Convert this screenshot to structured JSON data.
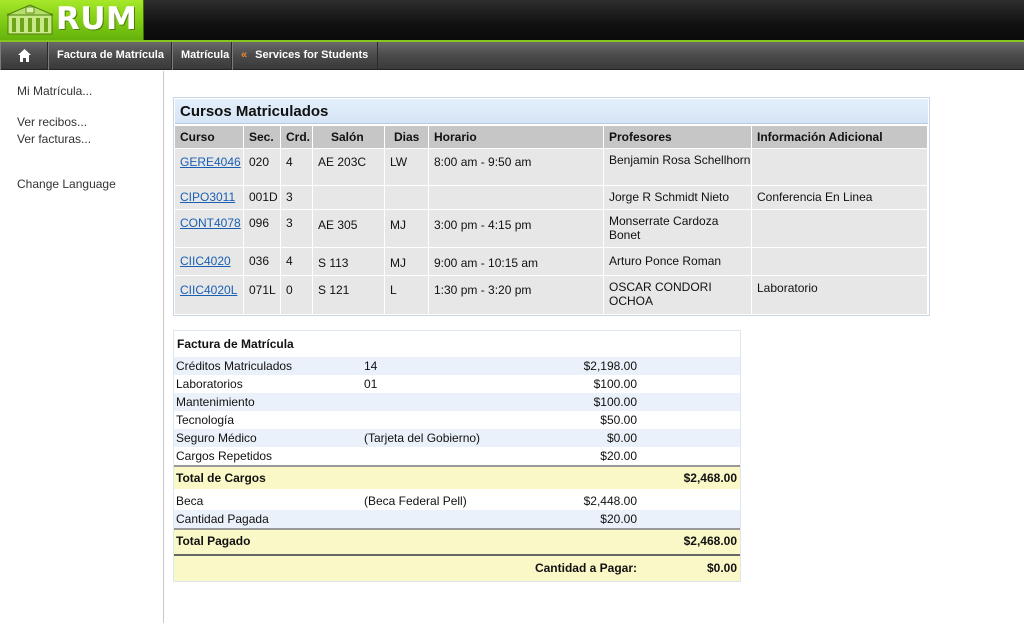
{
  "header": {
    "logo_text": "RUM"
  },
  "nav": {
    "items": [
      {
        "label": "Factura de Matrícula"
      },
      {
        "label": "Matrícula"
      },
      {
        "label": "Services for Students"
      }
    ]
  },
  "sidebar": {
    "items": [
      {
        "label": "Mi Matrícula..."
      },
      {
        "label": "Ver recibos..."
      },
      {
        "label": "Ver facturas..."
      },
      {
        "label": "Change Language"
      }
    ]
  },
  "courses": {
    "title": "Cursos Matriculados",
    "headers": [
      "Curso",
      "Sec.",
      "Crd.",
      "Salón",
      "Dias",
      "Horario",
      "Profesores",
      "Información Adicional"
    ],
    "rows": [
      {
        "curso": "GERE4046",
        "sec": "020",
        "crd": "4",
        "salon": "AE 203C",
        "dias": "LW",
        "horario": "8:00 am - 9:50 am",
        "profesores": "Benjamin Rosa Schellhorn",
        "info": ""
      },
      {
        "curso": "CIPO3011",
        "sec": "001D",
        "crd": "3",
        "salon": "",
        "dias": "",
        "horario": "",
        "profesores": "Jorge R Schmidt Nieto",
        "info": "Conferencia En Linea"
      },
      {
        "curso": "CONT4078",
        "sec": "096",
        "crd": "3",
        "salon": "AE 305",
        "dias": "MJ",
        "horario": "3:00 pm - 4:15 pm",
        "profesores": "Monserrate Cardoza Bonet",
        "info": ""
      },
      {
        "curso": "CIIC4020",
        "sec": "036",
        "crd": "4",
        "salon": "S 113",
        "dias": "MJ",
        "horario": "9:00 am - 10:15 am",
        "profesores": "Arturo Ponce Roman",
        "info": ""
      },
      {
        "curso": "CIIC4020L",
        "sec": "071L",
        "crd": "0",
        "salon": "S 121",
        "dias": "L",
        "horario": "1:30 pm - 3:20 pm",
        "profesores": "OSCAR CONDORI OCHOA",
        "info": "Laboratorio"
      }
    ]
  },
  "invoice": {
    "title": "Factura de Matrícula",
    "charges": [
      {
        "label": "Créditos Matriculados",
        "desc": "14",
        "amount": "$2,198.00"
      },
      {
        "label": "Laboratorios",
        "desc": "01",
        "amount": "$100.00"
      },
      {
        "label": "Mantenimiento",
        "desc": "",
        "amount": "$100.00"
      },
      {
        "label": "Tecnología",
        "desc": "",
        "amount": "$50.00"
      },
      {
        "label": "Seguro Médico",
        "desc": "(Tarjeta del Gobierno)",
        "amount": "$0.00"
      },
      {
        "label": "Cargos Repetidos",
        "desc": "",
        "amount": "$20.00"
      }
    ],
    "total_cargos_label": "Total de Cargos",
    "total_cargos": "$2,468.00",
    "payments": [
      {
        "label": "Beca",
        "desc": "(Beca Federal Pell)",
        "amount": "$2,448.00"
      },
      {
        "label": "Cantidad Pagada",
        "desc": "",
        "amount": "$20.00"
      }
    ],
    "total_pagado_label": "Total Pagado",
    "total_pagado": "$2,468.00",
    "a_pagar_label": "Cantidad a Pagar:",
    "a_pagar": "$0.00"
  }
}
